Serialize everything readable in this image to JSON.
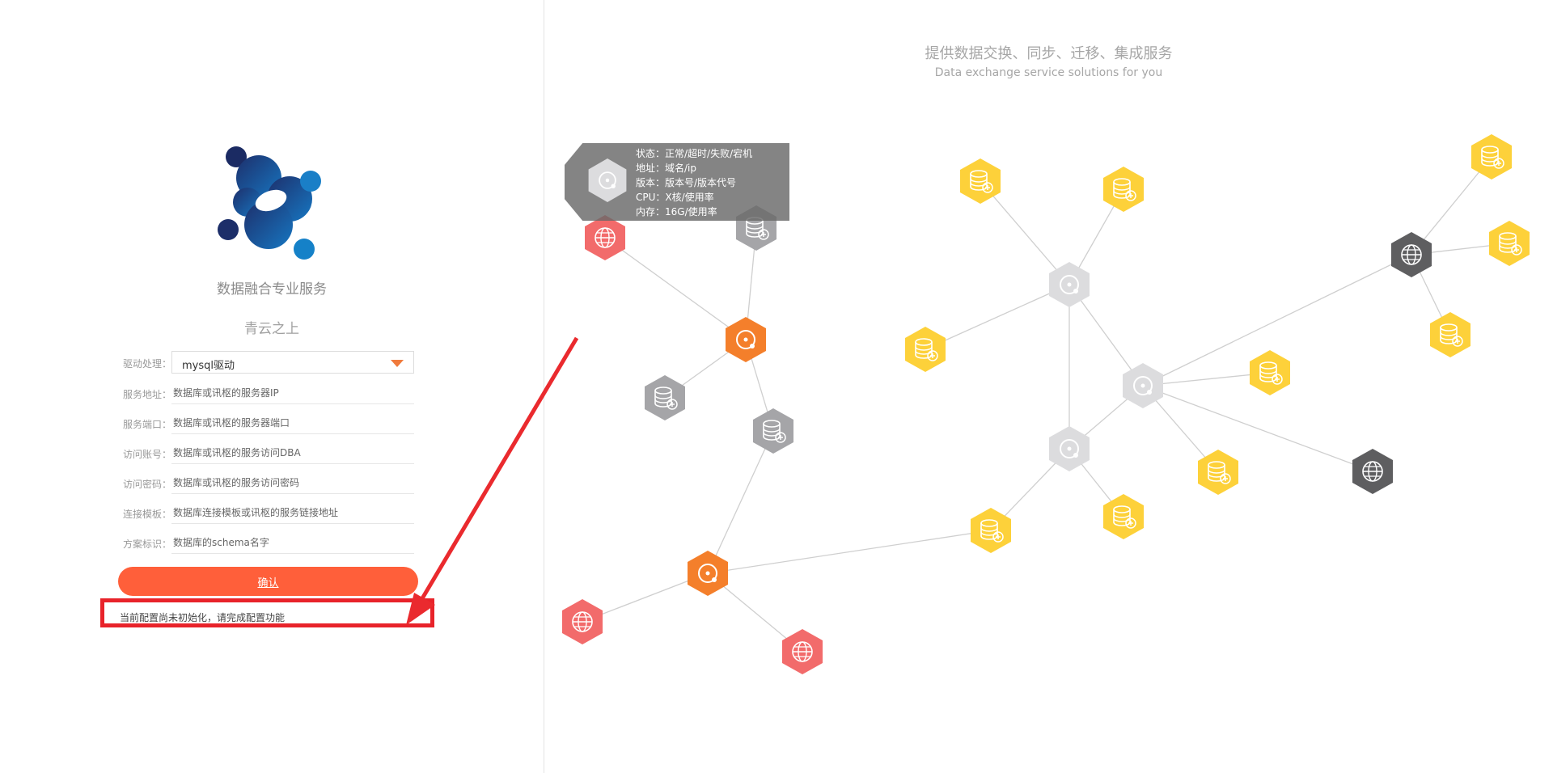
{
  "brand": {
    "title": "数据融合专业服务",
    "subtitle": "青云之上"
  },
  "form": {
    "driver_label": "驱动处理：",
    "driver_value": "mysql驱动",
    "fields": [
      {
        "label": "服务地址：",
        "placeholder": "数据库或讯枢的服务器IP"
      },
      {
        "label": "服务端口：",
        "placeholder": "数据库或讯枢的服务器端口"
      },
      {
        "label": "访问账号：",
        "placeholder": "数据库或讯枢的服务访问DBA"
      },
      {
        "label": "访问密码：",
        "placeholder": "数据库或讯枢的服务访问密码"
      },
      {
        "label": "连接模板：",
        "placeholder": "数据库连接模板或讯枢的服务链接地址"
      },
      {
        "label": "方案标识：",
        "placeholder": "数据库的schema名字"
      }
    ],
    "confirm_label": "确认",
    "status_message": "当前配置尚未初始化，请完成配置功能"
  },
  "header": {
    "title_cn": "提供数据交换、同步、迁移、集成服务",
    "title_en": "Data exchange service solutions for you"
  },
  "tooltip": {
    "lines": [
      "状态：正常/超时/失败/宕机",
      "地址：域名/ip",
      "版本：版本号/版本代号",
      "CPU：X核/使用率",
      "内存：16G/使用率"
    ]
  },
  "colors": {
    "accent": "#ff5f3a",
    "highlight_border": "#e8232a",
    "node_orange": "#f47f2b",
    "node_red": "#f26b6b",
    "node_gray": "#a5a5a8",
    "node_light": "#dcdcde",
    "node_dark": "#5e5e60",
    "node_yellow": "#fdd13a"
  },
  "icons": {
    "logo": "molecule-logo",
    "caret": "dropdown-caret-icon",
    "node_types": [
      "server-icon",
      "globe-icon",
      "database-add-icon"
    ]
  }
}
